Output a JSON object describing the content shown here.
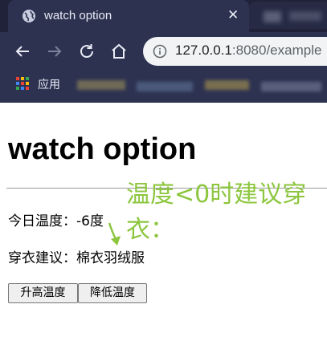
{
  "browser": {
    "tab_title": "watch option",
    "tab_close": "✕",
    "url_host": "127.0.0.1",
    "url_rest": ":8080/example",
    "bookmark_apps_label": "应用"
  },
  "icons": {
    "tab": "globe-icon",
    "back": "back-arrow-icon",
    "forward": "forward-arrow-icon",
    "reload": "reload-icon",
    "home": "home-icon",
    "site_info": "info-icon",
    "apps": "apps-grid-icon"
  },
  "page": {
    "heading": "watch option",
    "temperature_text": "今日温度：-6度",
    "clothing_text": "穿衣建议：棉衣羽绒服",
    "raise_button": "升高温度",
    "lower_button": "降低温度"
  },
  "annotation": {
    "text": "温度<0时建议穿衣：",
    "color": "#8cc63e"
  },
  "colors": {
    "chrome_dark": "#1f2238",
    "chrome_tab": "#2d3251"
  }
}
